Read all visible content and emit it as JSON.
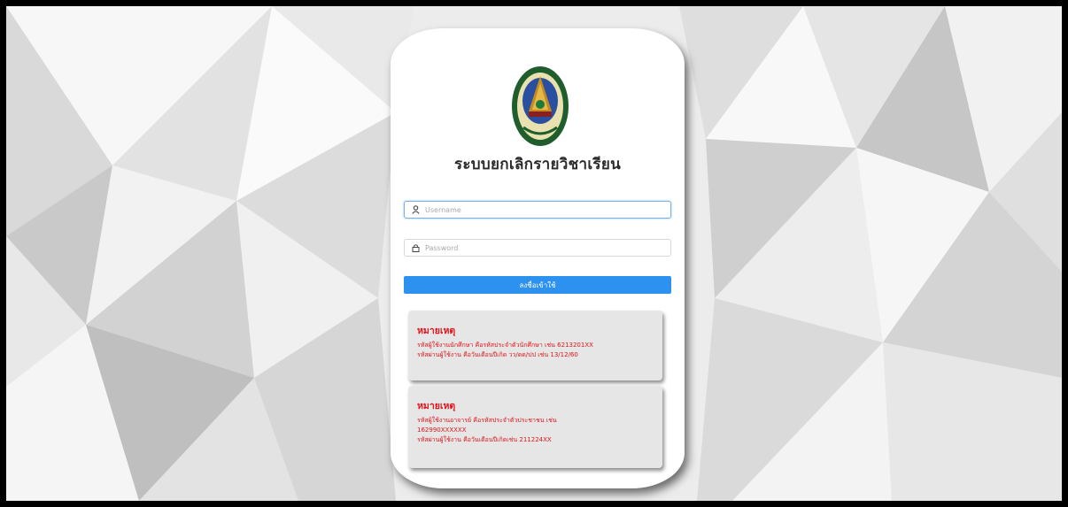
{
  "app": {
    "title": "ระบบยกเลิกรายวิชาเรียน"
  },
  "login": {
    "username_placeholder": "Username",
    "password_placeholder": "Password",
    "submit_label": "ลงชื่อเข้าใช้"
  },
  "notes": [
    {
      "title": "หมายเหตุ",
      "lines": [
        "รหัสผู้ใช้งานนักศึกษา คือรหัสประจำตัวนักศึกษา เช่น 6213201XX",
        "รหัสผ่านผู้ใช้งาน คือวันเดือนปีเกิด วว/ดด/ปป เช่น 13/12/60"
      ]
    },
    {
      "title": "หมายเหตุ",
      "lines": [
        "รหัสผู้ใช้งานอาจารย์ คือรหัสประจำตัวประชาชน เช่น",
        "162990XXXXXX",
        "รหัสผ่านผู้ใช้งาน คือวันเดือนปีเกิดเช่น 211224XX"
      ]
    }
  ],
  "icons": {
    "username": "user-icon",
    "password": "lock-icon"
  },
  "colors": {
    "accent": "#2d91f0",
    "note_text": "#e1151b",
    "note_bg": "#e6e6e6"
  }
}
